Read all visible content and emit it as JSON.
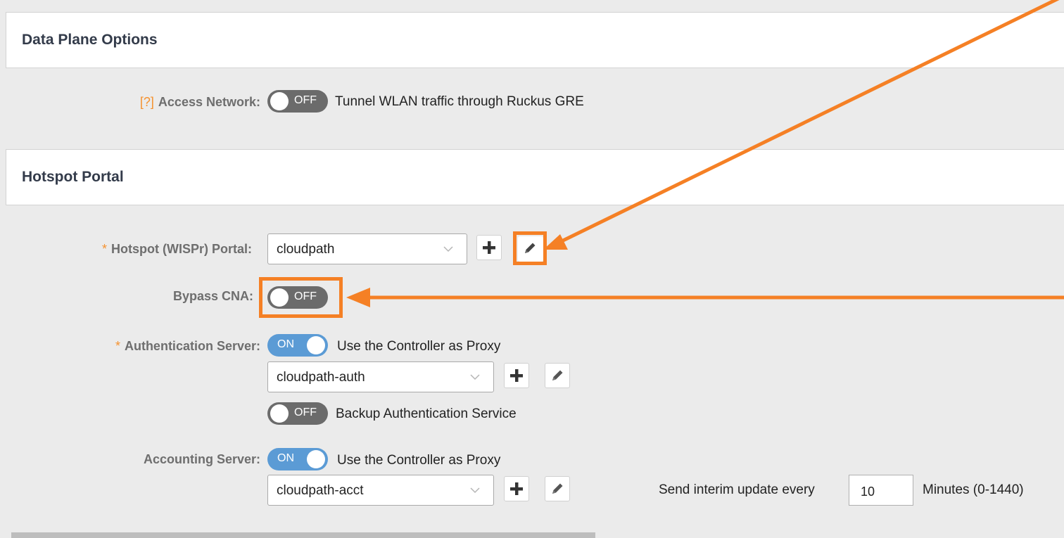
{
  "sections": {
    "data_plane": {
      "title": "Data Plane Options"
    },
    "hotspot": {
      "title": "Hotspot Portal"
    }
  },
  "access_network": {
    "help": "[?]",
    "label": "Access Network:",
    "toggle_state": "OFF",
    "description": "Tunnel WLAN traffic through Ruckus GRE"
  },
  "hotspot_portal": {
    "required": "*",
    "label": "Hotspot (WISPr) Portal:",
    "value": "cloudpath"
  },
  "bypass_cna": {
    "label": "Bypass CNA:",
    "toggle_state": "OFF"
  },
  "auth_server": {
    "required": "*",
    "label": "Authentication Server:",
    "toggle_state": "ON",
    "proxy_label": "Use the Controller as Proxy",
    "value": "cloudpath-auth",
    "backup_toggle_state": "OFF",
    "backup_label": "Backup Authentication Service"
  },
  "accounting_server": {
    "label": "Accounting Server:",
    "toggle_state": "ON",
    "proxy_label": "Use the Controller as Proxy",
    "value": "cloudpath-acct",
    "interim_label": "Send interim update every",
    "interim_value": "10",
    "interim_unit": "Minutes (0-1440)"
  },
  "colors": {
    "highlight": "#f58025",
    "toggle_on": "#5b9bd5",
    "toggle_off": "#6b6b6b",
    "required": "#f5922f"
  },
  "icons": {
    "add": "plus-icon",
    "edit": "pencil-icon",
    "dropdown": "chevron-down-icon"
  }
}
